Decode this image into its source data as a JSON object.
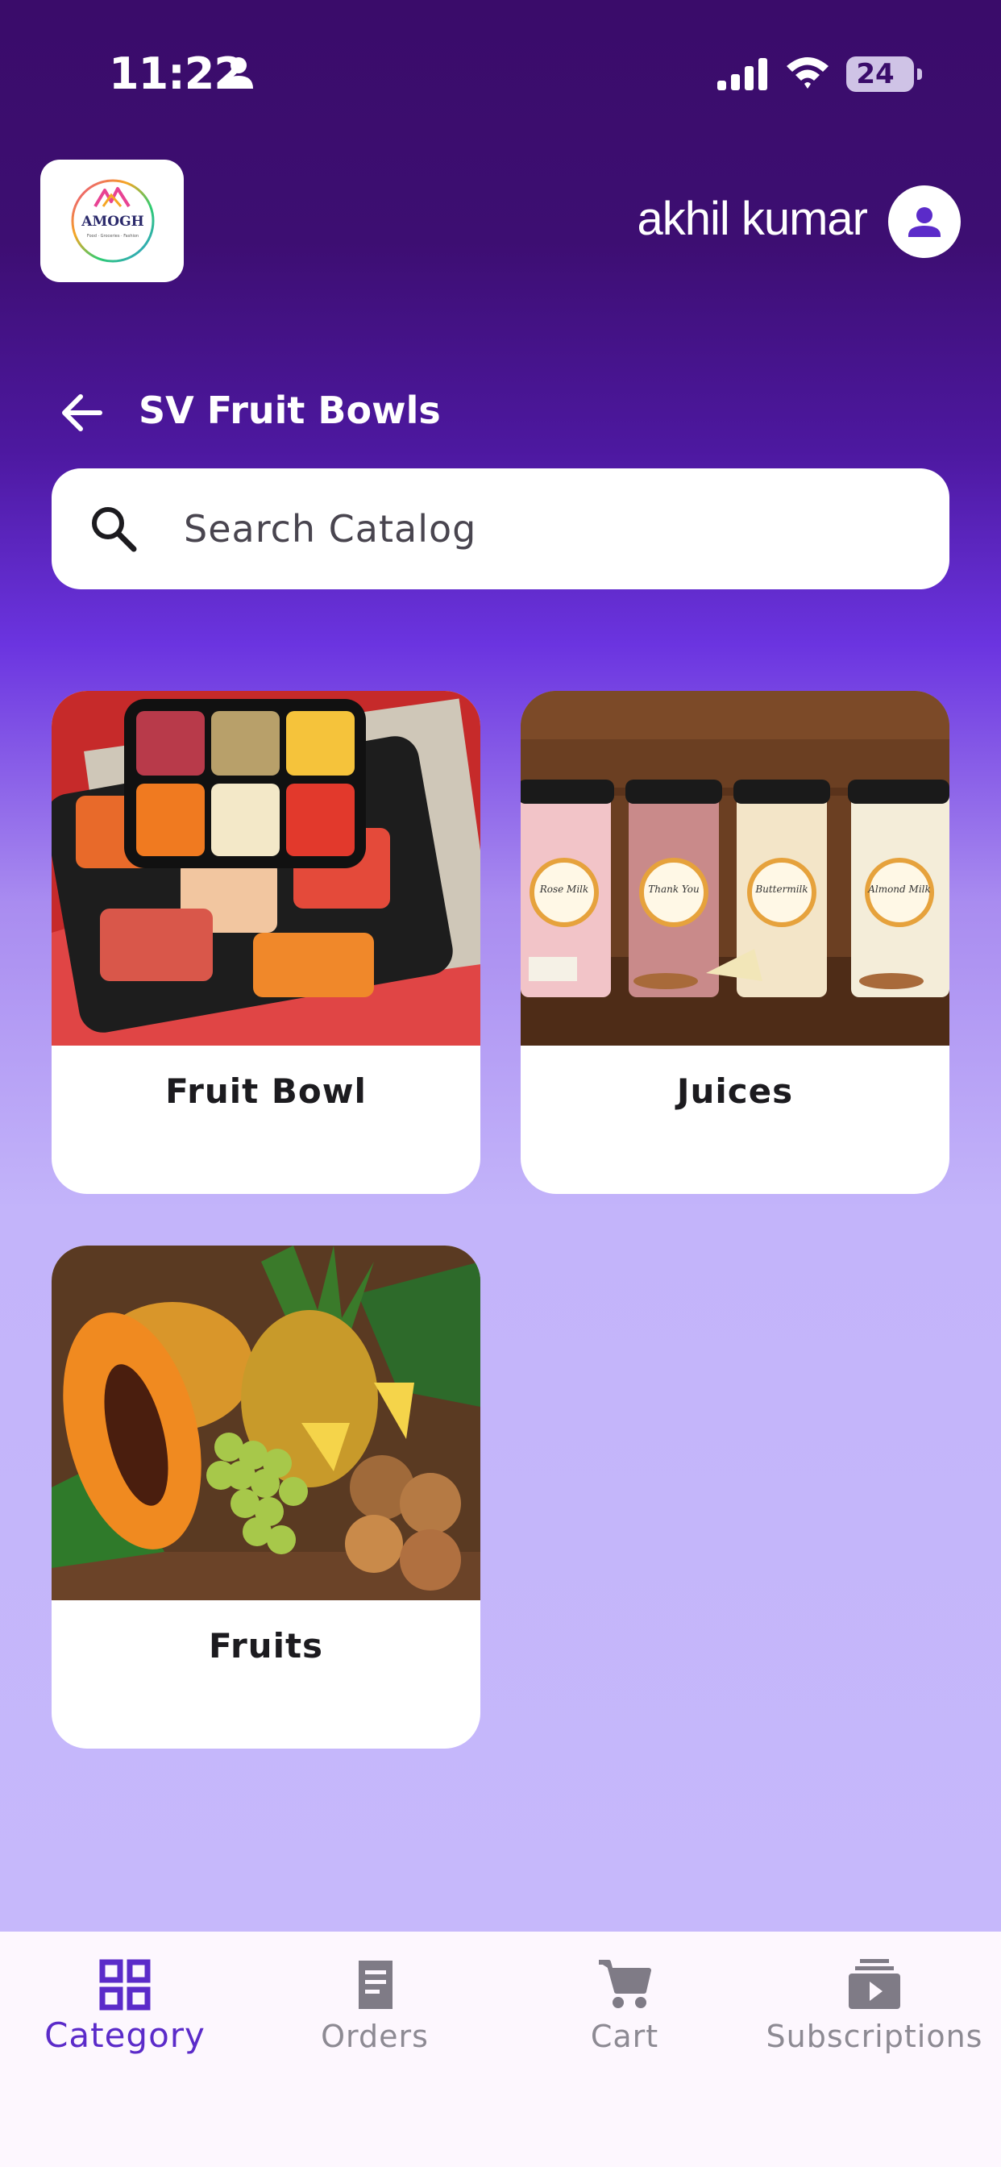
{
  "status_bar": {
    "time": "11:22",
    "battery": "24"
  },
  "header": {
    "logo_text": "AMOGH",
    "logo_tagline": "Food · Groceries · Fashion",
    "username": "akhil kumar"
  },
  "page": {
    "title": "SV Fruit Bowls"
  },
  "search": {
    "placeholder": "Search Catalog"
  },
  "categories": [
    {
      "label": "Fruit Bowl"
    },
    {
      "label": "Juices",
      "cup_labels": [
        "Rose Milk",
        "Thank You",
        "Buttermilk",
        "Almond Milk"
      ]
    },
    {
      "label": "Fruits"
    }
  ],
  "bottom_nav": {
    "items": [
      {
        "label": "Category",
        "icon": "grid-icon",
        "active": true
      },
      {
        "label": "Orders",
        "icon": "receipt-icon",
        "active": false
      },
      {
        "label": "Cart",
        "icon": "cart-icon",
        "active": false
      },
      {
        "label": "Subscriptions",
        "icon": "subscriptions-icon",
        "active": false
      }
    ]
  },
  "colors": {
    "accent": "#5b2bc9",
    "header_bg": "#3a0c6a",
    "body_bg": "#c6b8fb"
  }
}
